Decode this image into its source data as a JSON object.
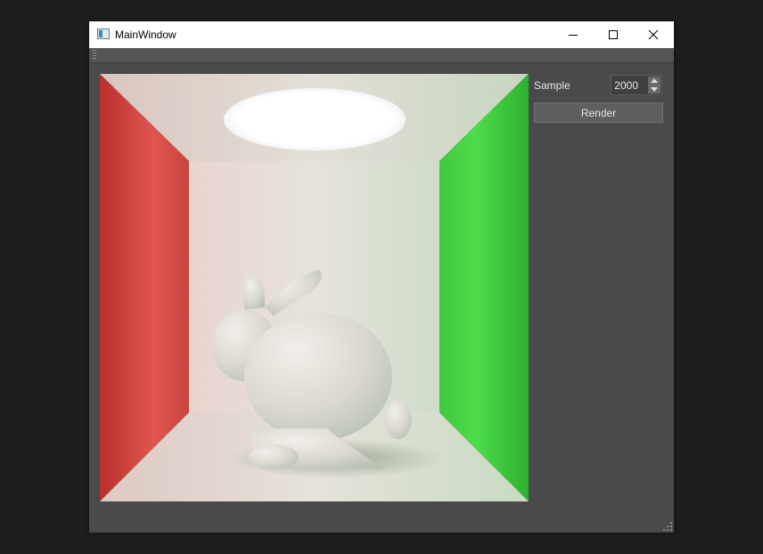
{
  "window": {
    "title": "MainWindow"
  },
  "controls": {
    "sample_label": "Sample",
    "sample_value": "2000",
    "render_label": "Render"
  },
  "render": {
    "scene": "cornell-box-bunny",
    "left_wall_color": "#dc4a45",
    "right_wall_color": "#3fd13f",
    "back_wall_color": "#e6e1dc",
    "light_color": "#ffffff"
  }
}
